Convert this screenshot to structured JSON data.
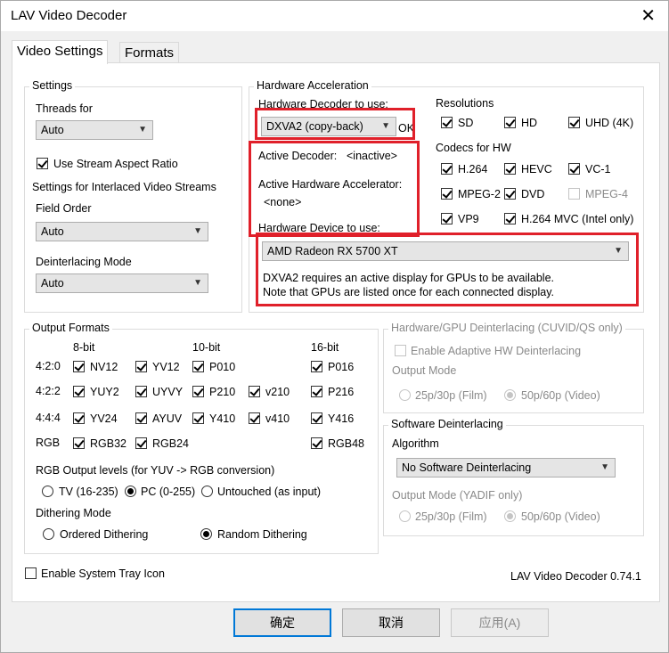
{
  "window": {
    "title": "LAV Video Decoder",
    "close_glyph": "✕"
  },
  "tabs": [
    "Video Settings",
    "Formats"
  ],
  "settings": {
    "group_label": "Settings",
    "threads_label": "Threads for",
    "threads_value": "Auto",
    "stream_aspect_label": "Use Stream Aspect Ratio",
    "stream_aspect_checked": true,
    "interlaced_label": "Settings for Interlaced Video Streams",
    "field_order_label": "Field Order",
    "field_order_value": "Auto",
    "deinterlacing_mode_label": "Deinterlacing Mode",
    "deinterlacing_mode_value": "Auto"
  },
  "hw_accel": {
    "group_label": "Hardware Acceleration",
    "decoder_label": "Hardware Decoder to use:",
    "decoder_value": "DXVA2 (copy-back)",
    "decoder_status": "OK",
    "active_decoder_label": "Active Decoder:",
    "active_decoder_value": "<inactive>",
    "active_accel_label": "Active Hardware Accelerator:",
    "active_accel_value": "<none>",
    "device_label": "Hardware Device to use:",
    "device_value": "AMD Radeon RX 5700 XT",
    "note_line1": "DXVA2 requires an active display for GPUs to be available.",
    "note_line2": "Note that GPUs are listed once for each connected display.",
    "resolutions_label": "Resolutions",
    "resolutions": [
      {
        "label": "SD",
        "checked": true
      },
      {
        "label": "HD",
        "checked": true
      },
      {
        "label": "UHD (4K)",
        "checked": true
      }
    ],
    "codecs_label": "Codecs for HW",
    "codecs": [
      {
        "label": "H.264",
        "checked": true,
        "enabled": true
      },
      {
        "label": "HEVC",
        "checked": true,
        "enabled": true
      },
      {
        "label": "VC-1",
        "checked": true,
        "enabled": true
      },
      {
        "label": "MPEG-2",
        "checked": true,
        "enabled": true
      },
      {
        "label": "DVD",
        "checked": true,
        "enabled": true
      },
      {
        "label": "MPEG-4",
        "checked": false,
        "enabled": false
      },
      {
        "label": "VP9",
        "checked": true,
        "enabled": true
      },
      {
        "label": "H.264 MVC (Intel only)",
        "checked": true,
        "enabled": true
      }
    ]
  },
  "output": {
    "group_label": "Output Formats",
    "col_headers": [
      "8-bit",
      "10-bit",
      "16-bit"
    ],
    "row_labels": [
      "4:2:0",
      "4:2:2",
      "4:4:4",
      "RGB"
    ],
    "formats": {
      "r420": [
        "NV12",
        "YV12",
        "P010",
        "P016"
      ],
      "r422": [
        "YUY2",
        "UYVY",
        "P210",
        "v210",
        "P216"
      ],
      "r444": [
        "YV24",
        "AYUV",
        "Y410",
        "v410",
        "Y416"
      ],
      "rgb": [
        "RGB32",
        "RGB24",
        "RGB48"
      ]
    },
    "levels_label": "RGB Output levels (for YUV -> RGB conversion)",
    "levels_options": [
      "TV (16-235)",
      "PC (0-255)",
      "Untouched (as input)"
    ],
    "levels_selected": "PC (0-255)",
    "dither_label": "Dithering Mode",
    "dither_options": [
      "Ordered Dithering",
      "Random Dithering"
    ],
    "dither_selected": "Random Dithering"
  },
  "hw_deint": {
    "group_label": "Hardware/GPU Deinterlacing (CUVID/QS only)",
    "adaptive_label": "Enable Adaptive HW Deinterlacing",
    "output_mode_label": "Output Mode",
    "options": [
      "25p/30p (Film)",
      "50p/60p (Video)"
    ]
  },
  "sw_deint": {
    "group_label": "Software Deinterlacing",
    "algorithm_label": "Algorithm",
    "algorithm_value": "No Software Deinterlacing",
    "output_mode_label": "Output Mode (YADIF only)",
    "options": [
      "25p/30p (Film)",
      "50p/60p (Video)"
    ]
  },
  "footer": {
    "tray_label": "Enable System Tray Icon",
    "version": "LAV Video Decoder 0.74.1"
  },
  "buttons": {
    "ok": "确定",
    "cancel": "取消",
    "apply": "应用(A)"
  }
}
